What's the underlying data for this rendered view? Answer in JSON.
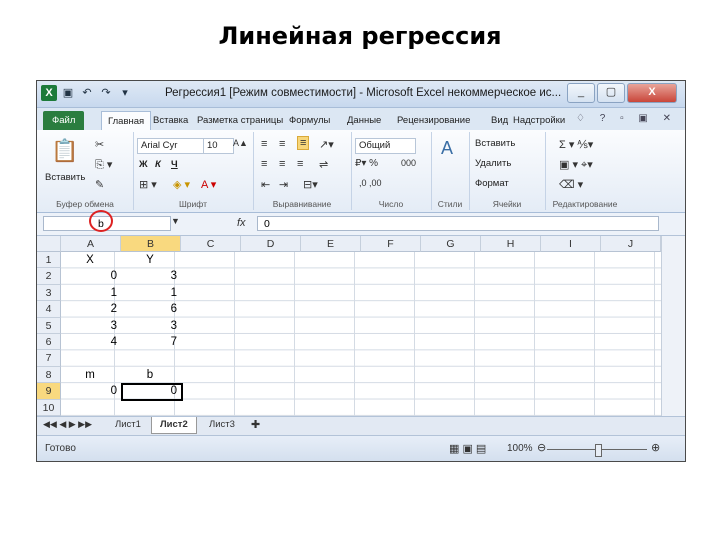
{
  "slide_title": "Линейная регрессия",
  "window": {
    "title": "Регрессия1 [Режим совместимости] - Microsoft Excel некоммерческое ис...",
    "controls": [
      "_",
      "▢",
      "X"
    ]
  },
  "qat": [
    "save-icon",
    "undo-icon",
    "redo-icon"
  ],
  "tabs": [
    "Файл",
    "Главная",
    "Вставка",
    "Разметка страницы",
    "Формулы",
    "Данные",
    "Рецензирование",
    "Вид",
    "Надстройки"
  ],
  "ribbon": {
    "clipboard": {
      "paste": "Вставить",
      "label": "Буфер обмена"
    },
    "font": {
      "name": "Arial Cyr",
      "size": "10",
      "bold": "Ж",
      "italic": "К",
      "underline": "Ч",
      "label": "Шрифт"
    },
    "align": {
      "label": "Выравнивание"
    },
    "number": {
      "format": "Общий",
      "label": "Число"
    },
    "styles": {
      "label": "Стили"
    },
    "cells": {
      "insert": "Вставить",
      "delete": "Удалить",
      "format": "Формат",
      "label": "Ячейки"
    },
    "editing": {
      "label": "Редактирование"
    }
  },
  "formula_bar": {
    "name_box": "b",
    "value": "0"
  },
  "columns": [
    "A",
    "B",
    "C",
    "D",
    "E",
    "F",
    "G",
    "H",
    "I",
    "J"
  ],
  "rows": [
    "1",
    "2",
    "3",
    "4",
    "5",
    "6",
    "7",
    "8",
    "9",
    "10"
  ],
  "cells": {
    "A1": "X",
    "B1": "Y",
    "A2": "0",
    "B2": "3",
    "A3": "1",
    "B3": "1",
    "A4": "2",
    "B4": "6",
    "A5": "3",
    "B5": "3",
    "A6": "4",
    "B6": "7",
    "A8": "m",
    "B8": "b",
    "A9": "0",
    "B9": "0"
  },
  "sheets": [
    "Лист1",
    "Лист2",
    "Лист3"
  ],
  "active_sheet": "Лист2",
  "status": {
    "text": "Готово",
    "zoom": "100%"
  }
}
